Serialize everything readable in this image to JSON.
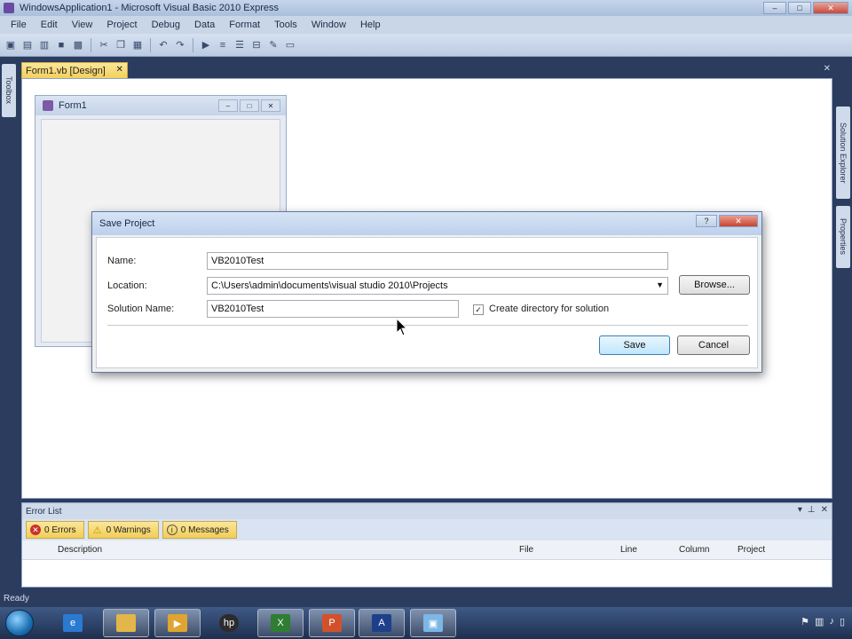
{
  "window": {
    "title": "WindowsApplication1 - Microsoft Visual Basic 2010 Express",
    "controls": [
      "–",
      "□",
      "✕"
    ]
  },
  "menu": [
    "File",
    "Edit",
    "View",
    "Project",
    "Debug",
    "Data",
    "Format",
    "Tools",
    "Window",
    "Help"
  ],
  "toolbar": {
    "icons": [
      "new-project-icon",
      "open-file-icon",
      "add-item-icon",
      "save-icon",
      "save-all-icon",
      "cut-icon",
      "copy-icon",
      "paste-icon",
      "undo-icon",
      "redo-icon",
      "start-debugging-icon",
      "align-icon",
      "layout-icon",
      "format-icon",
      "properties-icon",
      "toolbox-icon"
    ]
  },
  "side_tabs": {
    "left": [
      "Toolbox"
    ],
    "right": [
      "Solution Explorer",
      "Properties"
    ]
  },
  "document_tab": {
    "label": "Form1.vb [Design]",
    "close": "✕"
  },
  "designer_form": {
    "title": "Form1",
    "controls": [
      "–",
      "□",
      "✕"
    ]
  },
  "dialog": {
    "title": "Save Project",
    "name_label": "Name:",
    "name_value": "VB2010Test",
    "location_label": "Location:",
    "location_value": "C:\\Users\\admin\\documents\\visual studio 2010\\Projects",
    "browse_label": "Browse...",
    "solution_label": "Solution Name:",
    "solution_value": "VB2010Test",
    "create_dir_label": "Create directory for solution",
    "create_dir_checked": true,
    "save_label": "Save",
    "cancel_label": "Cancel"
  },
  "error_list": {
    "title": "Error List",
    "errors_label": "0 Errors",
    "warnings_label": "0 Warnings",
    "messages_label": "0 Messages",
    "columns": [
      "Description",
      "File",
      "Line",
      "Column",
      "Project"
    ]
  },
  "status": {
    "text": "Ready"
  },
  "taskbar": {
    "apps": [
      "internet-explorer-icon",
      "file-explorer-icon",
      "media-player-icon",
      "hp-icon",
      "excel-icon",
      "powerpoint-icon",
      "visual-studio-icon",
      "visual-basic-icon"
    ]
  }
}
